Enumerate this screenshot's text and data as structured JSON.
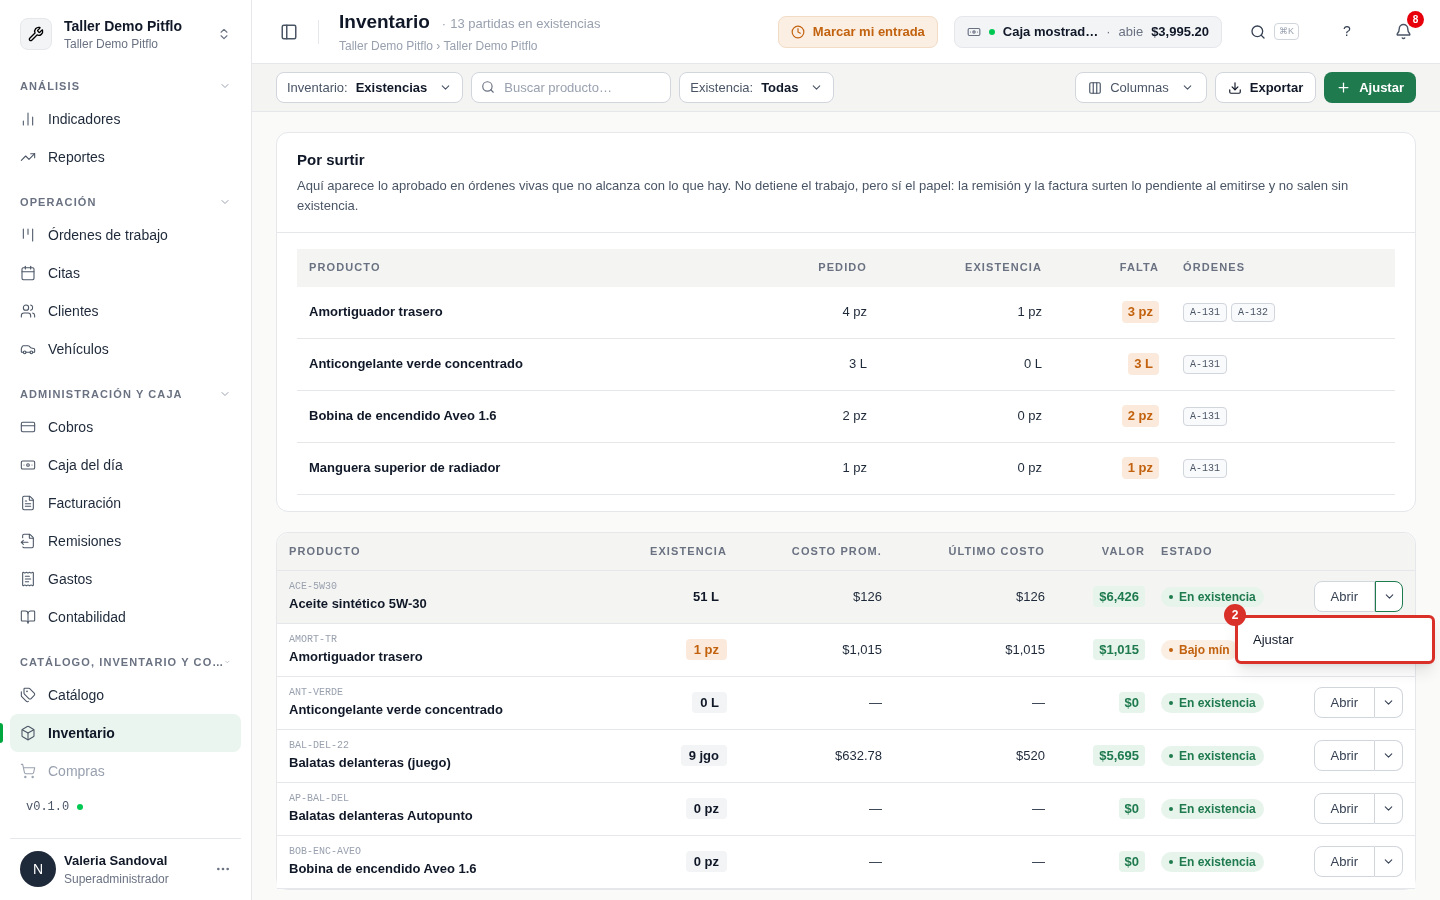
{
  "workspace": {
    "name": "Taller Demo Pitflo",
    "subtitle": "Taller Demo Pitflo"
  },
  "sidebar": {
    "sections": [
      {
        "title": "ANÁLISIS",
        "expanded": true,
        "items": [
          {
            "label": "Indicadores",
            "selected": false
          },
          {
            "label": "Reportes",
            "selected": false
          }
        ]
      },
      {
        "title": "OPERACIÓN",
        "expanded": true,
        "items": [
          {
            "label": "Órdenes de trabajo",
            "selected": false
          },
          {
            "label": "Citas",
            "selected": false
          },
          {
            "label": "Clientes",
            "selected": false
          },
          {
            "label": "Vehículos",
            "selected": false
          }
        ]
      },
      {
        "title": "ADMINISTRACIÓN Y CAJA",
        "expanded": true,
        "items": [
          {
            "label": "Cobros",
            "selected": false
          },
          {
            "label": "Caja del día",
            "selected": false
          },
          {
            "label": "Facturación",
            "selected": false
          },
          {
            "label": "Remisiones",
            "selected": false
          },
          {
            "label": "Gastos",
            "selected": false
          },
          {
            "label": "Contabilidad",
            "selected": false
          }
        ]
      },
      {
        "title": "CATÁLOGO, INVENTARIO Y CO…",
        "expanded": true,
        "items": [
          {
            "label": "Catálogo",
            "selected": false
          },
          {
            "label": "Inventario",
            "selected": true
          },
          {
            "label": "Compras",
            "selected": false,
            "faded": true
          }
        ]
      }
    ],
    "version": "v0.1.0",
    "user": {
      "initial": "N",
      "name": "Valeria Sandoval",
      "role": "Superadministrador"
    }
  },
  "header": {
    "title": "Inventario",
    "separator": "·",
    "count": "13 partidas en existencias",
    "breadcrumb": "Taller Demo Pitflo › Taller Demo Pitflo",
    "clock_button": "Marcar mi entrada",
    "register": {
      "name": "Caja mostrad…",
      "status": "abie",
      "amount": "$3,995.20"
    },
    "shortcut": "⌘K",
    "help": "?",
    "notifications": "8"
  },
  "toolbar": {
    "inventory_filter": {
      "label": "Inventario:",
      "value": "Existencias"
    },
    "search": {
      "placeholder": "Buscar producto…"
    },
    "stock_filter": {
      "label": "Existencia:",
      "value": "Todas"
    },
    "columns_button": "Columnas",
    "export_button": "Exportar",
    "adjust_button": "Ajustar"
  },
  "shortage": {
    "title": "Por surtir",
    "description": "Aquí aparece lo aprobado en órdenes vivas que no alcanza con lo que hay. No detiene el trabajo, pero sí el papel: la remisión y la factura surten lo pendiente al emitirse y no salen sin existencia.",
    "columns": [
      "PRODUCTO",
      "PEDIDO",
      "EXISTENCIA",
      "FALTA",
      "ÓRDENES"
    ],
    "rows": [
      {
        "product": "Amortiguador trasero",
        "ordered": "4 pz",
        "stock": "1 pz",
        "missing": "3 pz",
        "orders": [
          "A-131",
          "A-132"
        ]
      },
      {
        "product": "Anticongelante verde concentrado",
        "ordered": "3 L",
        "stock": "0 L",
        "missing": "3 L",
        "orders": [
          "A-131"
        ]
      },
      {
        "product": "Bobina de encendido Aveo 1.6",
        "ordered": "2 pz",
        "stock": "0 pz",
        "missing": "2 pz",
        "orders": [
          "A-131"
        ]
      },
      {
        "product": "Manguera superior de radiador",
        "ordered": "1 pz",
        "stock": "0 pz",
        "missing": "1 pz",
        "orders": [
          "A-131"
        ]
      }
    ]
  },
  "inventory": {
    "columns": [
      "PRODUCTO",
      "EXISTENCIA",
      "COSTO PROM.",
      "ÚLTIMO COSTO",
      "VALOR",
      "ESTADO"
    ],
    "rows": [
      {
        "sku": "ACE-5W30",
        "name": "Aceite sintético 5W-30",
        "stock": "51 L",
        "stock_low": false,
        "avg_cost": "$126",
        "last_cost": "$126",
        "value": "$6,426",
        "status": "En existencia",
        "status_low": false,
        "open": "Abrir",
        "actions_visible": true,
        "selected": true
      },
      {
        "sku": "AMORT-TR",
        "name": "Amortiguador trasero",
        "stock": "1 pz",
        "stock_low": true,
        "avg_cost": "$1,015",
        "last_cost": "$1,015",
        "value": "$1,015",
        "status": "Bajo mín",
        "status_low": true,
        "actions_visible": false,
        "selected": false
      },
      {
        "sku": "ANT-VERDE",
        "name": "Anticongelante verde concentrado",
        "stock": "0 L",
        "stock_low": false,
        "avg_cost": "—",
        "last_cost": "—",
        "value": "$0",
        "status": "En existencia",
        "status_low": false,
        "open": "Abrir",
        "actions_visible": true,
        "selected": false
      },
      {
        "sku": "BAL-DEL-22",
        "name": "Balatas delanteras (juego)",
        "stock": "9 jgo",
        "stock_low": false,
        "avg_cost": "$632.78",
        "last_cost": "$520",
        "value": "$5,695",
        "status": "En existencia",
        "status_low": false,
        "open": "Abrir",
        "actions_visible": true,
        "selected": false
      },
      {
        "sku": "AP-BAL-DEL",
        "name": "Balatas delanteras Autopunto",
        "stock": "0 pz",
        "stock_low": false,
        "avg_cost": "—",
        "last_cost": "—",
        "value": "$0",
        "status": "En existencia",
        "status_low": false,
        "open": "Abrir",
        "actions_visible": true,
        "selected": false
      },
      {
        "sku": "BOB-ENC-AVEO",
        "name": "Bobina de encendido Aveo 1.6",
        "stock": "0 pz",
        "stock_low": false,
        "avg_cost": "—",
        "last_cost": "—",
        "value": "$0",
        "status": "En existencia",
        "status_low": false,
        "open": "Abrir",
        "actions_visible": true,
        "selected": false
      }
    ]
  },
  "row_menu": {
    "step": "2",
    "items": [
      "Ajustar"
    ]
  }
}
